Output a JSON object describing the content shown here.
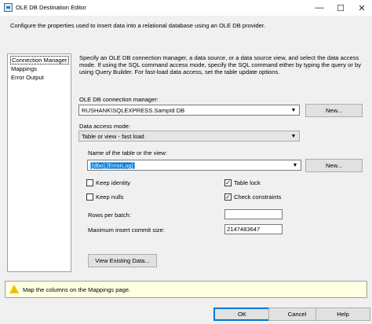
{
  "window": {
    "title": "OLE DB Destination Editor",
    "minimize": "—",
    "maximize": "☐",
    "close": "✕"
  },
  "description": "Configure the properties used to insert data into a relational database using an OLE DB provider.",
  "nav": {
    "items": [
      "Connection Manager",
      "Mappings",
      "Error Output"
    ]
  },
  "intro": "Specify an OLE DB connection manager, a data source, or a data source view, and select the data access mode. If using the SQL command access mode, specify the SQL command either by typing the query or by using Query Builder. For fast-load data access, set the table update options.",
  "connection": {
    "label": "OLE DB connection manager:",
    "value": "RUSHANK\\SQLEXPRESS.SampId DB",
    "new_label": "New..."
  },
  "access_mode": {
    "label": "Data access mode:",
    "value": "Table or view - fast load"
  },
  "table": {
    "label": "Name of the table or the view:",
    "value": "[dbo].[ErrorLog]",
    "new_label": "New..."
  },
  "options": {
    "keep_identity": "Keep identity",
    "keep_nulls": "Keep nulls",
    "table_lock": "Table lock",
    "check_constraints": "Check constraints",
    "rows_per_batch_label": "Rows per batch:",
    "rows_per_batch_value": "",
    "max_commit_label": "Maximum insert commit size:",
    "max_commit_value": "2147483647"
  },
  "view_existing": "View Existing Data...",
  "warning": "Map the columns on the Mappings page.",
  "footer": {
    "ok": "OK",
    "cancel": "Cancel",
    "help": "Help"
  },
  "glyphs": {
    "check": "✓",
    "arrow": "▼"
  }
}
